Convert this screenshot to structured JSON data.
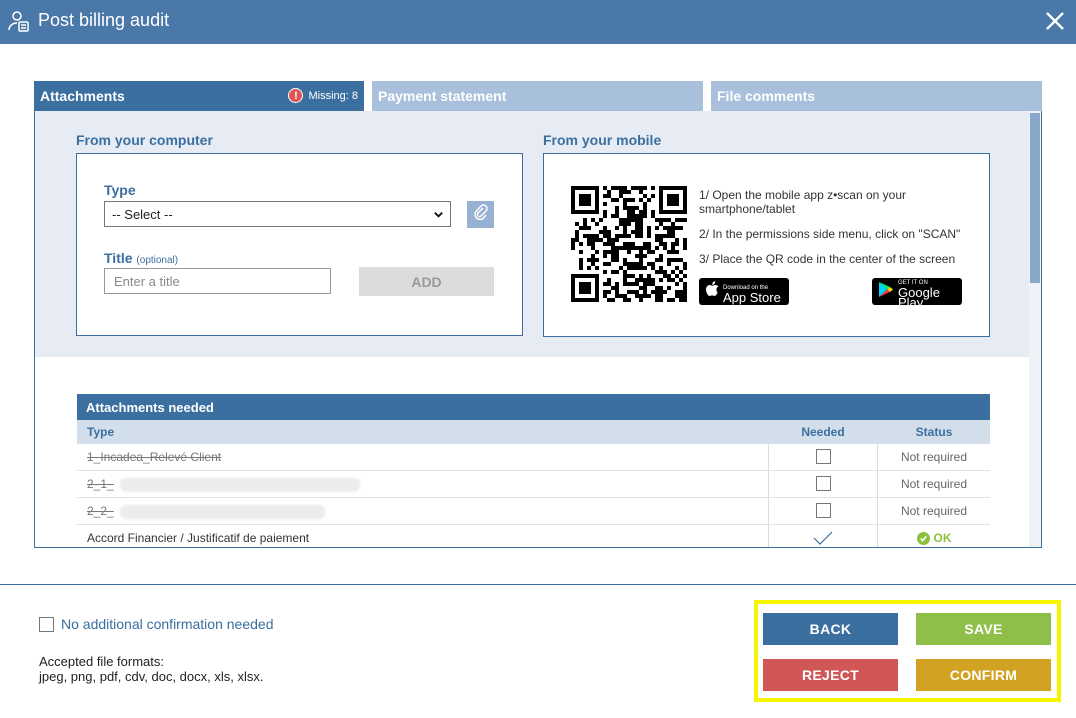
{
  "window": {
    "title": "Post billing audit",
    "title_icon": "audit-user-icon",
    "close_icon": "close-icon"
  },
  "tabs": [
    {
      "label": "Attachments",
      "active": true,
      "missing_label": "Missing: 8"
    },
    {
      "label": "Payment statement",
      "active": false
    },
    {
      "label": "File comments",
      "active": false
    }
  ],
  "computer": {
    "section_title": "From your computer",
    "type_label": "Type",
    "type_value": "-- Select --",
    "title_label": "Title",
    "title_optional": "(optional)",
    "title_placeholder": "Enter a title",
    "add_label": "ADD"
  },
  "mobile": {
    "section_title": "From your mobile",
    "step1": "1/ Open the mobile app z•scan on your smartphone/tablet",
    "step2": "2/ In the permissions side menu, click on \"SCAN\"",
    "step3": "3/ Place the QR code in the center of the screen",
    "appstore_small": "Download on the",
    "appstore_big": "App Store",
    "googleplay_small": "GET IT ON",
    "googleplay_big": "Google Play"
  },
  "attachments": {
    "header": "Attachments needed",
    "columns": {
      "type": "Type",
      "needed": "Needed",
      "status": "Status"
    },
    "rows": [
      {
        "type": "1_Incadea_Relevé Client",
        "struck": true,
        "needed": false,
        "status": "Not required"
      },
      {
        "type": "2_1_",
        "struck": true,
        "needed": false,
        "status": "Not required"
      },
      {
        "type": "2_2_",
        "struck": true,
        "needed": false,
        "status": "Not required"
      },
      {
        "type": "Accord Financier / Justificatif de paiement",
        "struck": false,
        "needed": true,
        "status": "OK"
      }
    ]
  },
  "footer": {
    "no_confirm_label": "No additional confirmation needed",
    "formats_title": "Accepted file formats:",
    "formats_list": "jpeg, png, pdf, cdv, doc, docx, xls, xlsx.",
    "buttons": {
      "back": "BACK",
      "save": "SAVE",
      "reject": "REJECT",
      "confirm": "CONFIRM"
    }
  },
  "colors": {
    "primary": "#3a6fa0",
    "titlebar": "#4a78a8",
    "save": "#8ec049",
    "reject": "#d15757",
    "confirm": "#d2a322",
    "highlight": "#f5f500"
  }
}
